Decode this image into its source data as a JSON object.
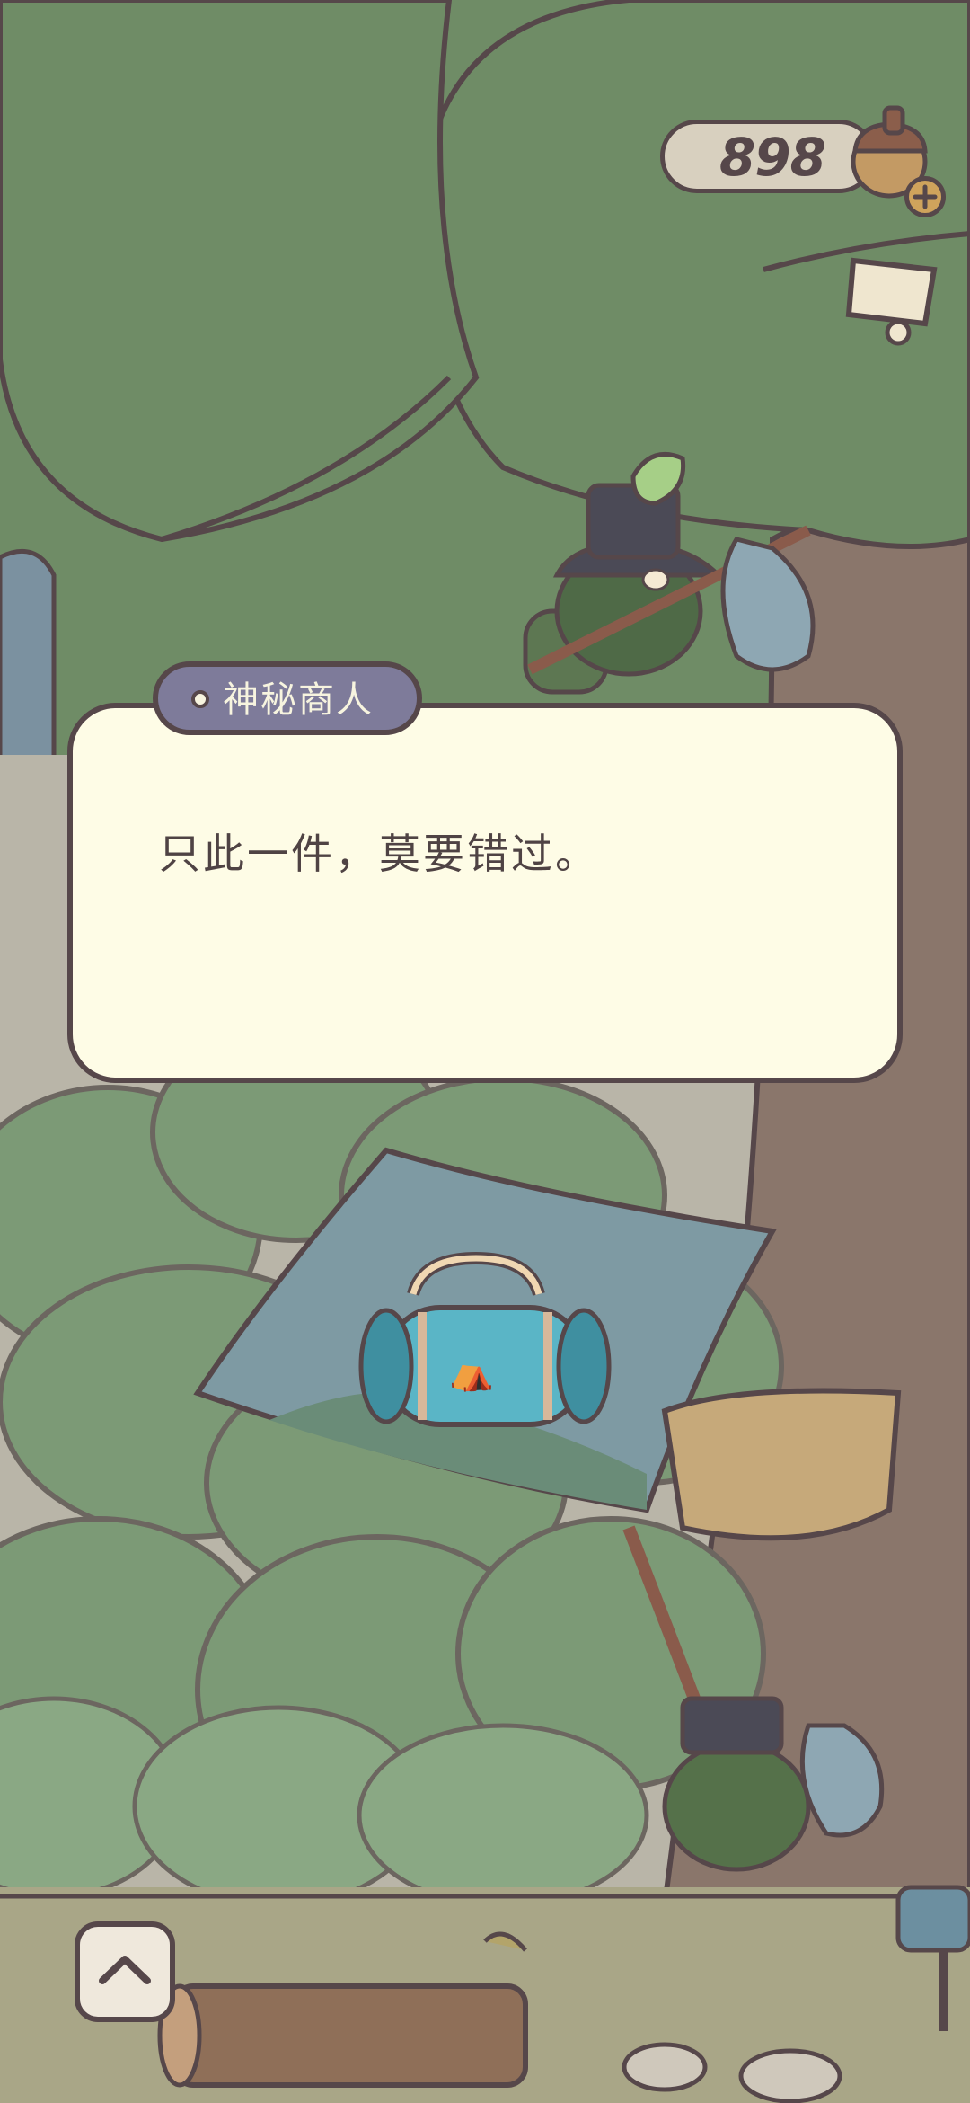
{
  "currency": {
    "amount": "898",
    "icon": "acorn-icon",
    "add_icon": "plus-icon"
  },
  "dialog": {
    "speaker": "神秘商人",
    "message": "只此一件，莫要错过。"
  },
  "item": {
    "icon": "duffel-bag-icon"
  },
  "controls": {
    "expand_icon": "chevron-up-icon",
    "letter_icon": "letter-icon",
    "mailbox_icon": "mailbox-icon"
  },
  "colors": {
    "outline": "#56474a",
    "dialog_bg": "#fefce6",
    "speaker_tag": "#7e7b9a",
    "sky": "#6f8c66",
    "bag": "#5ab5c6"
  }
}
